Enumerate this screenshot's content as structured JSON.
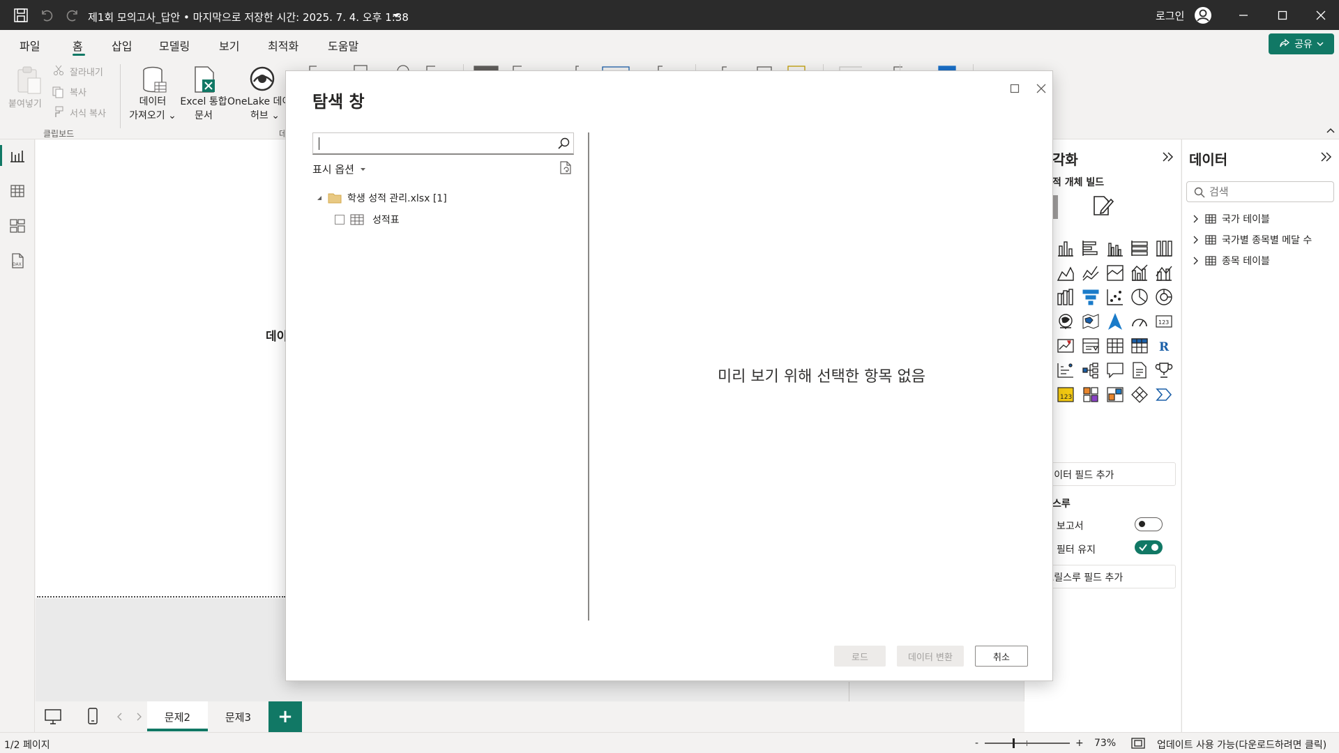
{
  "titlebar": {
    "document_title": "제1회 모의고사_답안 • 마지막으로 저장한 시간: 2025. 7. 4. 오후 1:38",
    "login_label": "로그인",
    "icons": [
      "save-icon",
      "undo-icon",
      "redo-icon",
      "avatar-icon",
      "minimize-icon",
      "maximize-icon",
      "close-icon"
    ]
  },
  "menubar": {
    "items": [
      {
        "label": "파일"
      },
      {
        "label": "홈"
      },
      {
        "label": "삽입"
      },
      {
        "label": "모델링"
      },
      {
        "label": "보기"
      },
      {
        "label": "최적화"
      },
      {
        "label": "도움말"
      }
    ],
    "active_index": 1,
    "share_label": "공유"
  },
  "ribbon": {
    "paste_label": "붙여넣기",
    "cut_label": "잘라내기",
    "copy_label": "복사",
    "format_painter_label": "서식 복사",
    "clipboard_group": "클립보드",
    "get_data_line1": "데이터",
    "get_data_line2": "가져오기",
    "excel_line1": "Excel 통합",
    "excel_line2": "문서",
    "onelake_line1": "OneLake 데이",
    "onelake_line2": "허브",
    "group_partial": "데"
  },
  "canvas": {
    "partial_text": "데이"
  },
  "viz_pane": {
    "title_partial": "각화",
    "build_label": "적 개체 빌드",
    "add_data_fields": "에 데이터 필드 추가",
    "drillthrough_header": "스루",
    "report_label": "보고서",
    "keep_filters_label": "필터 유지",
    "report_toggle_on": false,
    "keep_filters_toggle_on": true,
    "add_drillthrough_fields": "에 드릴스루 필드 추가"
  },
  "data_pane": {
    "title": "데이터",
    "search_placeholder": "검색",
    "tables": [
      {
        "label": "국가 테이블"
      },
      {
        "label": "국가별 종목별 메달 수"
      },
      {
        "label": "종목 테이블"
      }
    ]
  },
  "page_tabs": {
    "tabs": [
      {
        "label": "문제2",
        "active": true
      },
      {
        "label": "문제3",
        "active": false
      }
    ],
    "add_label": "+"
  },
  "statusbar": {
    "page_indicator": "1/2 페이지",
    "zoom_minus": "-",
    "zoom_plus": "+",
    "zoom_percent": "73%",
    "update_message": "업데이트 사용 가능(다운로드하려면 클릭)"
  },
  "navigator": {
    "title": "탐색 창",
    "search_value": "",
    "display_options_label": "표시 옵션",
    "tree": {
      "file_label": "학생 성적 관리.xlsx [1]",
      "sheet_label": "성적표",
      "sheet_checked": false
    },
    "empty_message": "미리 보기 위해 선택한 항목 없음",
    "load_label": "로드",
    "transform_label": "데이터 변환",
    "cancel_label": "취소"
  },
  "colors": {
    "accent": "#117865",
    "titlebar_bg": "#2b2b2b",
    "ribbon_bg": "#f3f2f1"
  }
}
